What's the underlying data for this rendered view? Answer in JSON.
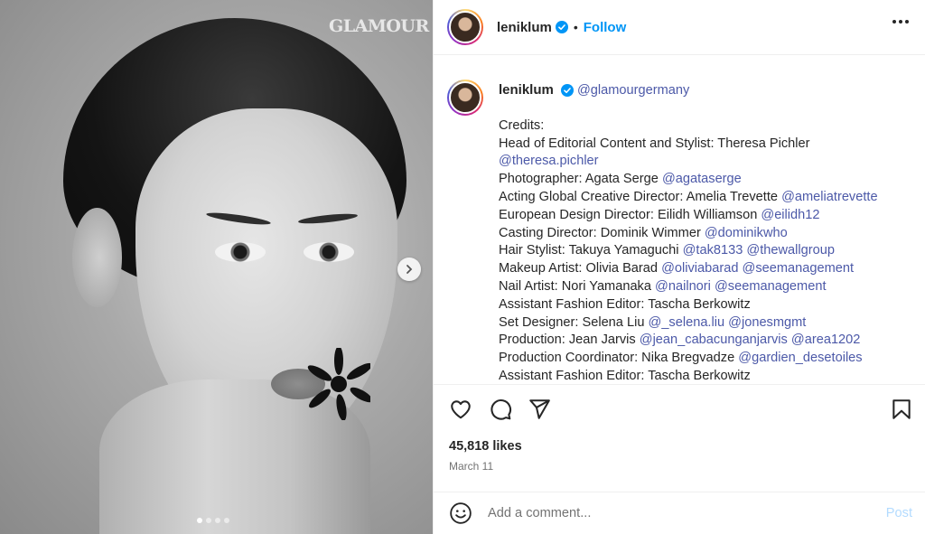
{
  "photo": {
    "watermark": "GLAMOUR",
    "carousel_dots": 4,
    "active_dot": 0
  },
  "header": {
    "username": "leniklum",
    "separator": "•",
    "follow_label": "Follow"
  },
  "caption": {
    "username": "leniklum",
    "mention": "@glamourgermany",
    "lines": [
      [
        {
          "t": "Credits:"
        }
      ],
      [
        {
          "t": "Head of Editorial Content and Stylist: Theresa Pichler"
        }
      ],
      [
        {
          "t": "@theresa.pichler",
          "link": true
        }
      ],
      [
        {
          "t": "Photographer: Agata Serge "
        },
        {
          "t": "@agataserge",
          "link": true
        }
      ],
      [
        {
          "t": "Acting Global Creative Director: Amelia Trevette "
        },
        {
          "t": "@ameliatrevette",
          "link": true
        }
      ],
      [
        {
          "t": "European Design Director: Eilidh Williamson "
        },
        {
          "t": "@eilidh12",
          "link": true
        }
      ],
      [
        {
          "t": "Casting Director: Dominik Wimmer "
        },
        {
          "t": "@dominikwho",
          "link": true
        }
      ],
      [
        {
          "t": "Hair Stylist: Takuya Yamaguchi "
        },
        {
          "t": "@tak8133",
          "link": true
        },
        {
          "t": " "
        },
        {
          "t": "@thewallgroup",
          "link": true
        }
      ],
      [
        {
          "t": "Makeup Artist: Olivia Barad "
        },
        {
          "t": "@oliviabarad",
          "link": true
        },
        {
          "t": " "
        },
        {
          "t": "@seemanagement",
          "link": true
        }
      ],
      [
        {
          "t": "Nail Artist: Nori Yamanaka "
        },
        {
          "t": "@nailnori",
          "link": true
        },
        {
          "t": " "
        },
        {
          "t": "@seemanagement",
          "link": true
        }
      ],
      [
        {
          "t": "Assistant Fashion Editor: Tascha Berkowitz"
        }
      ],
      [
        {
          "t": "Set Designer: Selena Liu "
        },
        {
          "t": "@_selena.liu",
          "link": true
        },
        {
          "t": " "
        },
        {
          "t": "@jonesmgmt",
          "link": true
        }
      ],
      [
        {
          "t": "Production: Jean Jarvis "
        },
        {
          "t": "@jean_cabacunganjarvis",
          "link": true
        },
        {
          "t": " "
        },
        {
          "t": "@area1202",
          "link": true
        }
      ],
      [
        {
          "t": "Production Coordinator: Nika Bregvadze "
        },
        {
          "t": "@gardien_desetoiles",
          "link": true
        }
      ],
      [
        {
          "t": "Assistant Fashion Editor: Tascha Berkowitz"
        }
      ]
    ]
  },
  "actions": {
    "icons": [
      "heart-icon",
      "comment-icon",
      "share-icon",
      "bookmark-icon"
    ]
  },
  "stats": {
    "likes": "45,818 likes",
    "date": "March 11"
  },
  "comment": {
    "placeholder": "Add a comment...",
    "post_label": "Post"
  },
  "colors": {
    "link": "#4c59a8",
    "follow": "#0095f6",
    "post_disabled": "#b3dbff",
    "verified": "#0095f6"
  }
}
